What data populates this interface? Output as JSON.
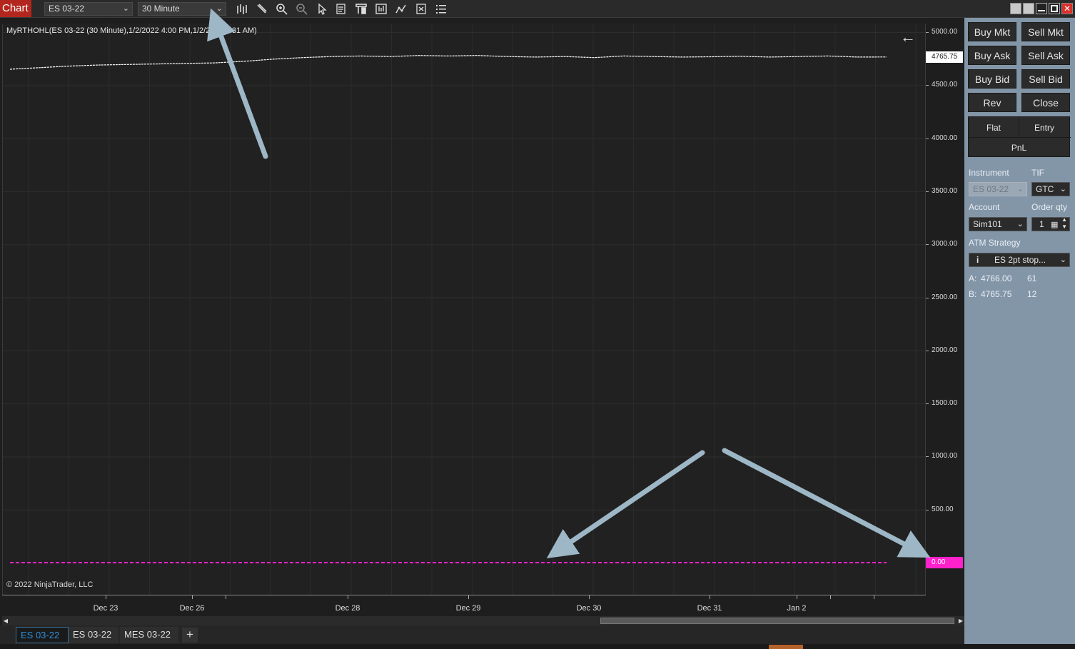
{
  "toolbar": {
    "title": "Chart",
    "instrument": "ES 03-22",
    "interval": "30 Minute",
    "icons": [
      "bars-type-icon",
      "draw-pencil-icon",
      "zoom-in-icon",
      "zoom-out-icon",
      "pointer-icon",
      "data-series-icon",
      "chart-trader-icon",
      "strategies-icon",
      "indicators-icon",
      "properties-icon",
      "object-list-icon"
    ]
  },
  "chart": {
    "indicator_label": "MyRTHOHL(ES 03-22 (30 Minute),1/2/2022 4:00 PM,1/2/2022 ...31 AM)",
    "copyright": "© 2022 NinjaTrader, LLC",
    "last_price": "4765.75",
    "indicator_value": "0.00",
    "price_color": "#ffffff",
    "indicator_color": "#ff22cc",
    "y_ticks": [
      "5000.00",
      "4500.00",
      "4000.00",
      "3500.00",
      "3000.00",
      "2500.00",
      "2000.00",
      "1500.00",
      "1000.00",
      "500.00"
    ],
    "x_ticks": [
      "Dec 23",
      "Dec 26",
      "Dec 28",
      "Dec 29",
      "Dec 30",
      "Dec 31",
      "Jan 2"
    ]
  },
  "chart_data": {
    "type": "line",
    "xlabel": "",
    "ylabel": "",
    "ylim": [
      -100,
      5050
    ],
    "series": [
      {
        "values": [
          4650,
          4665,
          4680,
          4690,
          4695,
          4700,
          4705,
          4710,
          4725,
          4745,
          4760,
          4770,
          4775,
          4770,
          4780,
          4775,
          4780,
          4770,
          4765,
          4770,
          4760,
          4775,
          4770,
          4765,
          4768,
          4772,
          4765,
          4770,
          4775,
          4765,
          4765.75
        ]
      },
      {
        "values": [
          0,
          0
        ]
      }
    ]
  },
  "tabs": [
    {
      "label": "ES 03-22",
      "active": true
    },
    {
      "label": "ES 03-22",
      "active": false
    },
    {
      "label": "MES 03-22",
      "active": false
    }
  ],
  "add_tab_label": "+",
  "order_panel": {
    "buy_mkt": "Buy Mkt",
    "sell_mkt": "Sell Mkt",
    "buy_ask": "Buy Ask",
    "sell_ask": "Sell Ask",
    "buy_bid": "Buy Bid",
    "sell_bid": "Sell Bid",
    "rev": "Rev",
    "close": "Close",
    "flat": "Flat",
    "entry": "Entry",
    "pnl": "PnL",
    "instrument_label": "Instrument",
    "instrument_value": "ES 03-22",
    "tif_label": "TIF",
    "tif_value": "GTC",
    "account_label": "Account",
    "account_value": "Sim101",
    "order_qty_label": "Order qty",
    "order_qty_value": "1",
    "atm_label": "ATM Strategy",
    "atm_value": "ES 2pt stop...",
    "ask_label": "A:",
    "ask_price": "4766.00",
    "ask_size": "61",
    "bid_label": "B:",
    "bid_price": "4765.75",
    "bid_size": "12"
  }
}
